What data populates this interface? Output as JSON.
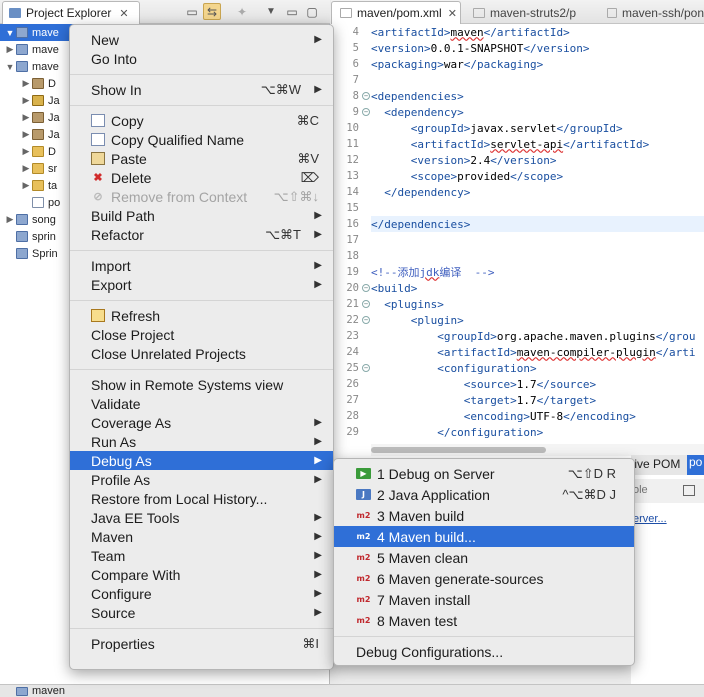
{
  "explorer": {
    "tab_title": "Project Explorer",
    "tree": [
      {
        "label": "mave",
        "indent": 0,
        "twisty": "▼",
        "icon": "project",
        "selected": true
      },
      {
        "label": "mave",
        "indent": 0,
        "twisty": "▶",
        "icon": "project",
        "selected": false
      },
      {
        "label": "mave",
        "indent": 0,
        "twisty": "▼",
        "icon": "project",
        "selected": false
      },
      {
        "label": "D",
        "indent": 1,
        "twisty": "▶",
        "icon": "jar",
        "selected": false
      },
      {
        "label": "Ja",
        "indent": 1,
        "twisty": "▶",
        "icon": "pkg",
        "selected": false
      },
      {
        "label": "Ja",
        "indent": 1,
        "twisty": "▶",
        "icon": "jar",
        "selected": false
      },
      {
        "label": "Ja",
        "indent": 1,
        "twisty": "▶",
        "icon": "jar",
        "selected": false
      },
      {
        "label": "D",
        "indent": 1,
        "twisty": "▶",
        "icon": "folder",
        "selected": false
      },
      {
        "label": "sr",
        "indent": 1,
        "twisty": "▶",
        "icon": "folder",
        "selected": false
      },
      {
        "label": "ta",
        "indent": 1,
        "twisty": "▶",
        "icon": "folder",
        "selected": false
      },
      {
        "label": "po",
        "indent": 1,
        "twisty": "",
        "icon": "file",
        "selected": false
      },
      {
        "label": "song",
        "indent": 0,
        "twisty": "▶",
        "icon": "project",
        "selected": false
      },
      {
        "label": "sprin",
        "indent": 0,
        "twisty": "",
        "icon": "project",
        "selected": false
      },
      {
        "label": "Sprin",
        "indent": 0,
        "twisty": "",
        "icon": "project",
        "selected": false
      }
    ],
    "bottom_label": "maven"
  },
  "editor": {
    "tabs": [
      "maven/pom.xml",
      "maven-struts2/p",
      "maven-ssh/pon"
    ],
    "line_numbers": [
      "4",
      "5",
      "6",
      "7",
      "8",
      "9",
      "10",
      "11",
      "12",
      "13",
      "14",
      "15",
      "16",
      "17",
      "18",
      "19",
      "20",
      "21",
      "22",
      "23",
      "24",
      "25",
      "26",
      "27",
      "28",
      "29"
    ],
    "lines": [
      {
        "indent": "",
        "parts": [
          [
            "tag",
            "<artifactId>"
          ],
          [
            "squig",
            "maven"
          ],
          [
            "tag",
            "</artifactId>"
          ]
        ]
      },
      {
        "indent": "",
        "parts": [
          [
            "tag",
            "<version>"
          ],
          [
            "txt",
            "0.0.1-SNAPSHOT"
          ],
          [
            "tag",
            "</version>"
          ]
        ]
      },
      {
        "indent": "",
        "parts": [
          [
            "tag",
            "<packaging>"
          ],
          [
            "txt",
            "war"
          ],
          [
            "tag",
            "</packaging>"
          ]
        ]
      },
      {
        "indent": "",
        "parts": []
      },
      {
        "indent": "",
        "parts": [
          [
            "tag",
            "<dependencies>"
          ]
        ]
      },
      {
        "indent": "  ",
        "parts": [
          [
            "tag",
            "<dependency>"
          ]
        ]
      },
      {
        "indent": "      ",
        "parts": [
          [
            "tag",
            "<groupId>"
          ],
          [
            "txt",
            "javax.servlet"
          ],
          [
            "tag",
            "</groupId>"
          ]
        ]
      },
      {
        "indent": "      ",
        "parts": [
          [
            "tag",
            "<artifactId>"
          ],
          [
            "squig",
            "servlet-api"
          ],
          [
            "tag",
            "</artifactId>"
          ]
        ]
      },
      {
        "indent": "      ",
        "parts": [
          [
            "tag",
            "<version>"
          ],
          [
            "txt",
            "2.4"
          ],
          [
            "tag",
            "</version>"
          ]
        ]
      },
      {
        "indent": "      ",
        "parts": [
          [
            "tag",
            "<scope>"
          ],
          [
            "txt",
            "provided"
          ],
          [
            "tag",
            "</scope>"
          ]
        ]
      },
      {
        "indent": "  ",
        "parts": [
          [
            "tag",
            "</dependency>"
          ]
        ]
      },
      {
        "indent": "",
        "parts": []
      },
      {
        "indent": "",
        "parts": [
          [
            "tag",
            "</dependencies>"
          ]
        ]
      },
      {
        "indent": "",
        "parts": []
      },
      {
        "indent": "",
        "parts": []
      },
      {
        "indent": "",
        "parts": [
          [
            "com",
            "<!--添加"
          ],
          [
            "squigcom",
            "jdk"
          ],
          [
            "com",
            "编译  -->"
          ]
        ]
      },
      {
        "indent": "",
        "parts": [
          [
            "tag",
            "<build>"
          ]
        ]
      },
      {
        "indent": "  ",
        "parts": [
          [
            "tag",
            "<plugins>"
          ]
        ]
      },
      {
        "indent": "      ",
        "parts": [
          [
            "tag",
            "<plugin>"
          ]
        ]
      },
      {
        "indent": "          ",
        "parts": [
          [
            "tag",
            "<groupId>"
          ],
          [
            "txt",
            "org.apache.maven.plugins"
          ],
          [
            "tag",
            "</grou"
          ]
        ]
      },
      {
        "indent": "          ",
        "parts": [
          [
            "tag",
            "<artifactId>"
          ],
          [
            "squig",
            "maven-compiler-plugin"
          ],
          [
            "tag",
            "</arti"
          ]
        ]
      },
      {
        "indent": "          ",
        "parts": [
          [
            "tag",
            "<configuration>"
          ]
        ]
      },
      {
        "indent": "              ",
        "parts": [
          [
            "tag",
            "<source>"
          ],
          [
            "txt",
            "1.7"
          ],
          [
            "tag",
            "</source>"
          ]
        ]
      },
      {
        "indent": "              ",
        "parts": [
          [
            "tag",
            "<target>"
          ],
          [
            "txt",
            "1.7"
          ],
          [
            "tag",
            "</target>"
          ]
        ]
      },
      {
        "indent": "              ",
        "parts": [
          [
            "tag",
            "<encoding>"
          ],
          [
            "txt",
            "UTF-8"
          ],
          [
            "tag",
            "</encoding>"
          ]
        ]
      },
      {
        "indent": "          ",
        "parts": [
          [
            "tag",
            "</configuration>"
          ]
        ]
      }
    ],
    "fold_lines": [
      "8",
      "9",
      "20",
      "21",
      "22",
      "25"
    ],
    "highlight_lines": [
      "16"
    ]
  },
  "lower_right": {
    "tab1": "tive POM",
    "tab2": "po",
    "console_label": "ole",
    "link": "erver..."
  },
  "context_menu": {
    "items": [
      {
        "type": "item",
        "label": "New",
        "arrow": true
      },
      {
        "type": "item",
        "label": "Go Into"
      },
      {
        "type": "sep"
      },
      {
        "type": "item",
        "label": "Show In",
        "shortcut": "⌥⌘W",
        "arrow": true
      },
      {
        "type": "sep"
      },
      {
        "type": "item",
        "label": "Copy",
        "shortcut": "⌘C",
        "icon": "copy"
      },
      {
        "type": "item",
        "label": "Copy Qualified Name",
        "icon": "copy"
      },
      {
        "type": "item",
        "label": "Paste",
        "shortcut": "⌘V",
        "icon": "paste"
      },
      {
        "type": "item",
        "label": "Delete",
        "shortcut": "⌦",
        "icon": "delete"
      },
      {
        "type": "item",
        "label": "Remove from Context",
        "shortcut": "⌥⇧⌘↓",
        "disabled": true,
        "icon": "remove"
      },
      {
        "type": "item",
        "label": "Build Path",
        "arrow": true
      },
      {
        "type": "item",
        "label": "Refactor",
        "shortcut": "⌥⌘T",
        "arrow": true
      },
      {
        "type": "sep"
      },
      {
        "type": "item",
        "label": "Import",
        "arrow": true
      },
      {
        "type": "item",
        "label": "Export",
        "arrow": true
      },
      {
        "type": "sep"
      },
      {
        "type": "item",
        "label": "Refresh",
        "icon": "refresh"
      },
      {
        "type": "item",
        "label": "Close Project"
      },
      {
        "type": "item",
        "label": "Close Unrelated Projects"
      },
      {
        "type": "sep"
      },
      {
        "type": "item",
        "label": "Show in Remote Systems view"
      },
      {
        "type": "item",
        "label": "Validate"
      },
      {
        "type": "item",
        "label": "Coverage As",
        "arrow": true
      },
      {
        "type": "item",
        "label": "Run As",
        "arrow": true
      },
      {
        "type": "item",
        "label": "Debug As",
        "arrow": true,
        "highlighted": true
      },
      {
        "type": "item",
        "label": "Profile As",
        "arrow": true
      },
      {
        "type": "item",
        "label": "Restore from Local History..."
      },
      {
        "type": "item",
        "label": "Java EE Tools",
        "arrow": true
      },
      {
        "type": "item",
        "label": "Maven",
        "arrow": true
      },
      {
        "type": "item",
        "label": "Team",
        "arrow": true
      },
      {
        "type": "item",
        "label": "Compare With",
        "arrow": true
      },
      {
        "type": "item",
        "label": "Configure",
        "arrow": true
      },
      {
        "type": "item",
        "label": "Source",
        "arrow": true
      },
      {
        "type": "sep"
      },
      {
        "type": "item",
        "label": "Properties",
        "shortcut": "⌘I"
      }
    ]
  },
  "debug_submenu": {
    "items": [
      {
        "type": "item",
        "label": "1 Debug on Server",
        "shortcut": "⌥⇧D R",
        "icon": "server"
      },
      {
        "type": "item",
        "label": "2 Java Application",
        "shortcut": "^⌥⌘D J",
        "icon": "java"
      },
      {
        "type": "item",
        "label": "3 Maven build",
        "icon": "m2"
      },
      {
        "type": "item",
        "label": "4 Maven build...",
        "icon": "m2",
        "highlighted": true
      },
      {
        "type": "item",
        "label": "5 Maven clean",
        "icon": "m2"
      },
      {
        "type": "item",
        "label": "6 Maven generate-sources",
        "icon": "m2"
      },
      {
        "type": "item",
        "label": "7 Maven install",
        "icon": "m2"
      },
      {
        "type": "item",
        "label": "8 Maven test",
        "icon": "m2"
      },
      {
        "type": "sep"
      },
      {
        "type": "item",
        "label": "Debug Configurations..."
      }
    ]
  },
  "icons": {
    "m2_text": "m2",
    "colors": {
      "selection": "#2f6fd7",
      "tag": "#1a4fa0",
      "comment": "#3f5fbf",
      "delete": "#d12c2c"
    }
  }
}
